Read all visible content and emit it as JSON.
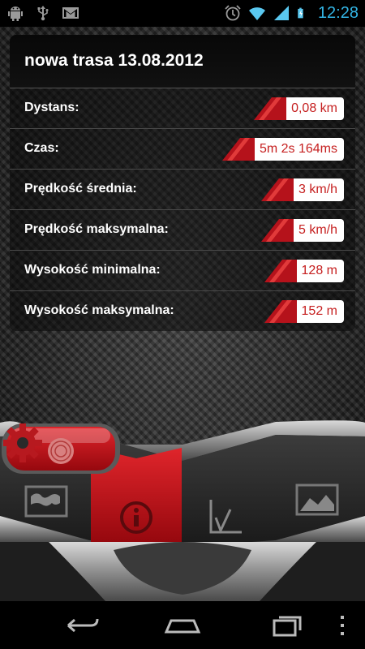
{
  "status_bar": {
    "time": "12:28",
    "icons_left": [
      "android-debug-icon",
      "usb-icon",
      "gmail-icon"
    ],
    "icons_right": [
      "alarm-icon",
      "wifi-icon",
      "signal-icon",
      "battery-charging-icon"
    ]
  },
  "route": {
    "title": "nowa trasa 13.08.2012",
    "stats": [
      {
        "label": "Dystans:",
        "value": "0,08 km"
      },
      {
        "label": "Czas:",
        "value": "5m 2s 164ms"
      },
      {
        "label": "Prędkość średnia:",
        "value": "3 km/h"
      },
      {
        "label": "Prędkość maksymalna:",
        "value": "5 km/h"
      },
      {
        "label": "Wysokość minimalna:",
        "value": "128 m"
      },
      {
        "label": "Wysokość maksymalna:",
        "value": "152 m"
      }
    ]
  },
  "dashboard": {
    "tabs": [
      "map-icon",
      "info-icon",
      "chart-icon",
      "elevation-icon"
    ],
    "active_tab": "info-icon",
    "accent_color": "#c8141a"
  },
  "nav_bar": [
    "back-icon",
    "home-icon",
    "recent-apps-icon",
    "menu-icon"
  ]
}
